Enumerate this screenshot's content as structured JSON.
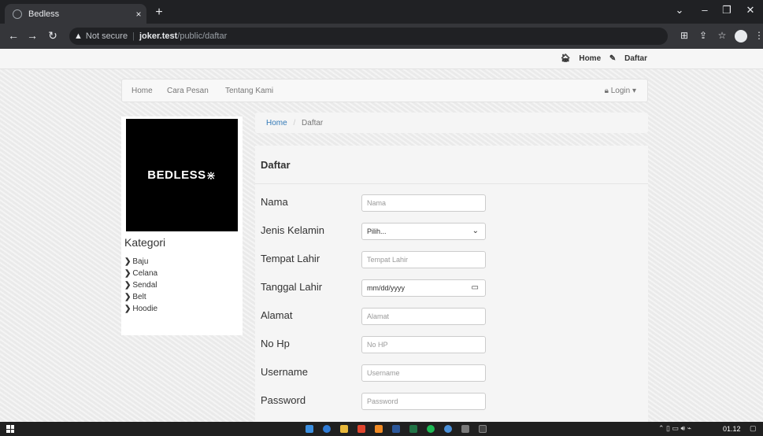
{
  "browser": {
    "tab_title": "Bedless",
    "tab_close": "×",
    "new_tab": "+",
    "address": {
      "security_label": "Not secure",
      "host": "joker.test",
      "path": "/public/daftar"
    }
  },
  "site": {
    "top_links": [
      "Home",
      "Daftar"
    ],
    "menu": [
      "Home",
      "Cara Pesan",
      "Tentang Kami"
    ],
    "login_label": "Login",
    "logo_text": "BEDLESS",
    "category_title": "Kategori",
    "categories": [
      "Baju",
      "Celana",
      "Sendal",
      "Belt",
      "Hoodie"
    ],
    "breadcrumb": {
      "home": "Home",
      "separator": "/",
      "current": "Daftar"
    },
    "form": {
      "title": "Daftar",
      "fields": [
        {
          "label": "Nama",
          "placeholder": "Nama"
        },
        {
          "label": "Jenis Kelamin",
          "value": "Pilih..."
        },
        {
          "label": "Tempat Lahir",
          "placeholder": "Tempat Lahir"
        },
        {
          "label": "Tanggal Lahir",
          "value": "mm/dd/yyyy"
        },
        {
          "label": "Alamat",
          "placeholder": "Alamat"
        },
        {
          "label": "No Hp",
          "placeholder": "No HP"
        },
        {
          "label": "Username",
          "placeholder": "Username"
        },
        {
          "label": "Password",
          "placeholder": "Password"
        }
      ]
    }
  },
  "taskbar": {
    "clock": "01.12"
  },
  "colors": {
    "link": "#337ab7",
    "chrome_dark": "#202124",
    "chrome_mid": "#35363a"
  }
}
